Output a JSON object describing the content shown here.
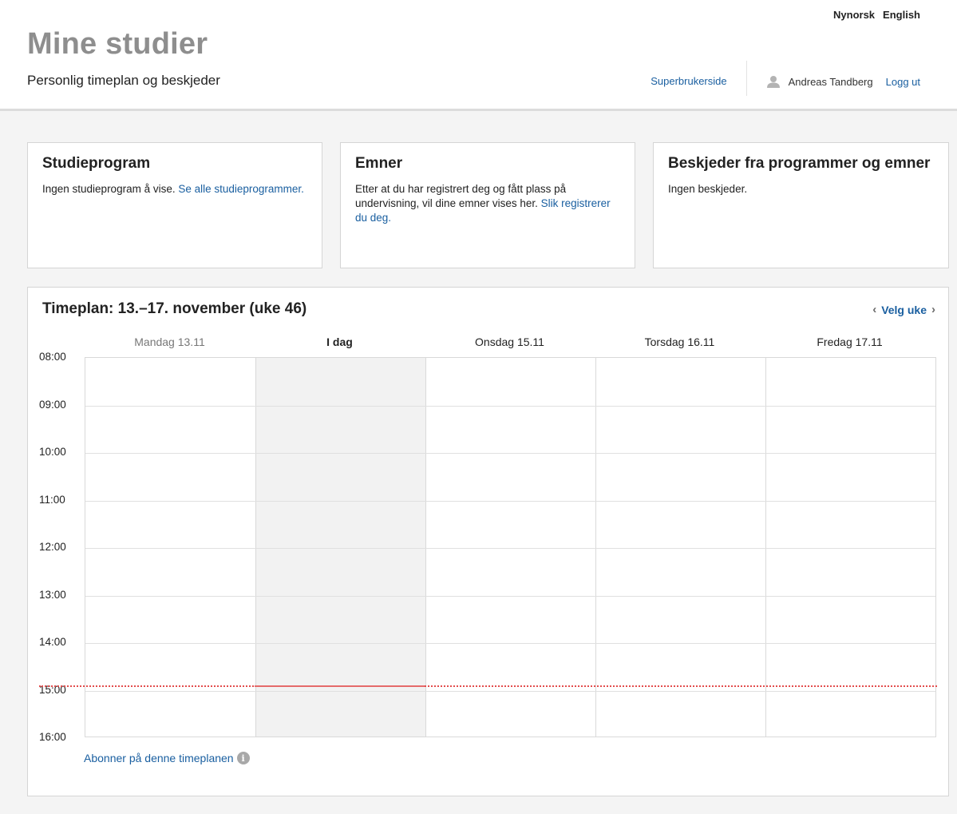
{
  "header": {
    "lang_nynorsk": "Nynorsk",
    "lang_english": "English",
    "title": "Mine studier",
    "subtitle": "Personlig timeplan og beskjeder",
    "superuser_link": "Superbrukerside",
    "user_name": "Andreas Tandberg",
    "logout_link": "Logg ut",
    "avatar_icon": "user-silhouette-icon"
  },
  "cards": {
    "program": {
      "title": "Studieprogram",
      "text": "Ingen studieprogram å vise. ",
      "link": "Se alle studieprogrammer."
    },
    "courses": {
      "title": "Emner",
      "text": "Etter at du har registrert deg og fått plass på undervisning, vil dine emner vises her. ",
      "link": "Slik registrerer du deg."
    },
    "messages": {
      "title": "Beskjeder fra programmer og emner",
      "text": "Ingen beskjeder."
    }
  },
  "schedule": {
    "title": "Timeplan: 13.–17. november (uke 46)",
    "week_nav_label": "Velg uke",
    "prev_icon": "chevron-left-icon",
    "next_icon": "chevron-right-icon",
    "days": [
      "Mandag 13.11",
      "I dag",
      "Onsdag 15.11",
      "Torsdag 16.11",
      "Fredag 17.11"
    ],
    "today_index": 1,
    "hours": [
      "08:00",
      "09:00",
      "10:00",
      "11:00",
      "12:00",
      "13:00",
      "14:00",
      "15:00",
      "16:00"
    ],
    "current_time_hours": 14.93,
    "subscribe_link": "Abonner på denne timeplanen",
    "info_icon": "info-icon",
    "now_line_color": "#e34d4d"
  }
}
